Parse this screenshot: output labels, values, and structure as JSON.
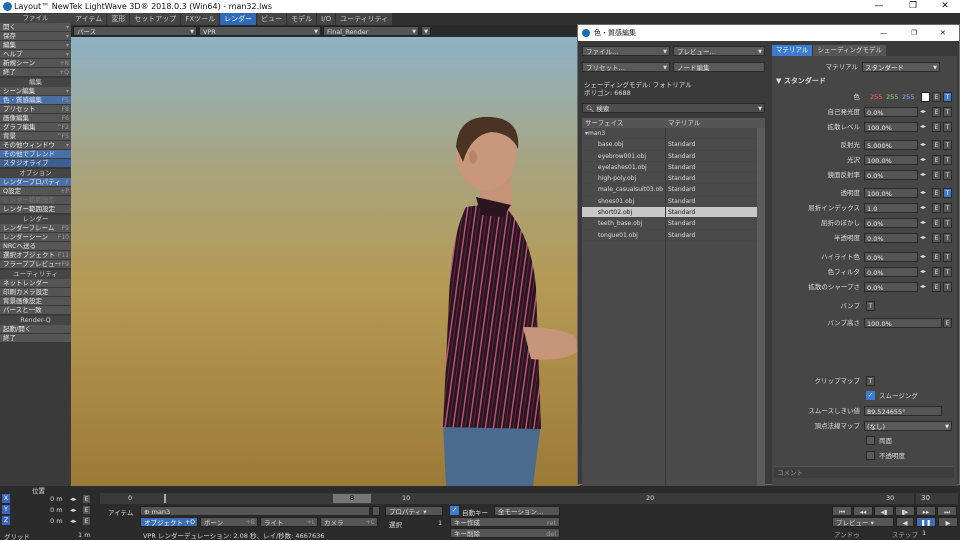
{
  "window": {
    "title": "Layout™ NewTek LightWave 3D® 2018.0.3 (Win64) - man32.lws",
    "controls": [
      "—",
      "❐",
      "✕"
    ]
  },
  "sidebar": {
    "sections": [
      {
        "title": "ファイル",
        "items": [
          {
            "label": "開く",
            "key": "▾"
          },
          {
            "label": "保存",
            "key": "▾"
          },
          {
            "label": "編集",
            "key": "▾"
          },
          {
            "label": "ヘルプ",
            "key": "▾"
          },
          {
            "label": "新規シーン",
            "key": "+N"
          },
          {
            "label": "終了",
            "key": "+Q"
          }
        ]
      },
      {
        "title": "編集",
        "items": [
          {
            "label": "シーン編集",
            "key": "▾"
          },
          {
            "label": "色・質感編集",
            "key": "F5",
            "active": true
          },
          {
            "label": "プリセット",
            "key": "F8"
          },
          {
            "label": "画像編集",
            "key": "F6"
          },
          {
            "label": "グラフ編集",
            "key": "^F2"
          },
          {
            "label": "背景",
            "key": "^F5"
          },
          {
            "label": "その他ウィンドウ",
            "key": "▾"
          },
          {
            "label": "その他でブレンド",
            "key": "",
            "active": true
          },
          {
            "label": "スタジオライブ",
            "key": "",
            "active2": true
          }
        ]
      },
      {
        "title": "オプション",
        "items": [
          {
            "label": "レンダープロパティ",
            "key": "F",
            "active": true
          },
          {
            "label": "Q設定",
            "key": "+P"
          },
          {
            "label": "レンダー範囲設定",
            "key": "",
            "disabled": true
          },
          {
            "label": "レンダー範囲設定",
            "key": ""
          }
        ]
      },
      {
        "title": "レンダー",
        "items": [
          {
            "label": "レンダーフレーム",
            "key": "F9"
          },
          {
            "label": "レンダーシーン",
            "key": "F10"
          },
          {
            "label": "NRCへ送る",
            "key": ""
          },
          {
            "label": "選択オブジェクト",
            "key": "F11"
          },
          {
            "label": "フラーブプレビュー",
            "key": "+F9"
          }
        ]
      },
      {
        "title": "ユーティリティ",
        "items": [
          {
            "label": "ネットレンダー",
            "key": ""
          },
          {
            "label": "印刷カメラ設定",
            "key": ""
          },
          {
            "label": "背景画像設定",
            "key": ""
          },
          {
            "label": "パースと一致",
            "key": ""
          }
        ]
      },
      {
        "title": "Render-Q",
        "items": [
          {
            "label": "起動/開く",
            "key": ""
          },
          {
            "label": "終了",
            "key": ""
          }
        ]
      }
    ]
  },
  "menubar": {
    "tabs": [
      "アイテム",
      "変形",
      "セットアップ",
      "FXツール",
      "レンダー",
      "ビュー",
      "モデル",
      "I/O",
      "ユーティリティ"
    ],
    "active": "レンダー"
  },
  "viewbar": {
    "view": "パース",
    "mode": "VPR",
    "render": "Final_Render"
  },
  "dialog": {
    "title": "色・質感編集",
    "file_btn": "ファイル…",
    "preview_btn": "プレビュー…",
    "preset_btn": "プリセット…",
    "node_btn": "ノード編集",
    "shading_model": "シェーディングモデル: フォトリアル",
    "polygons": "ポリゴン: 6688",
    "search": "検索",
    "col_surface": "サーフェイス",
    "col_material": "マテリアル",
    "root": "man3",
    "surfaces": [
      {
        "name": "base.obj",
        "material": "Standard"
      },
      {
        "name": "eyebrow001.obj",
        "material": "Standard"
      },
      {
        "name": "eyelashes01.obj",
        "material": "Standard"
      },
      {
        "name": "high-poly.obj",
        "material": "Standard"
      },
      {
        "name": "male_casualsuit03.ob",
        "material": "Standard"
      },
      {
        "name": "shoes01.obj",
        "material": "Standard"
      },
      {
        "name": "short02.obj",
        "material": "Standard",
        "selected": true
      },
      {
        "name": "teeth_base.obj",
        "material": "Standard"
      },
      {
        "name": "tongue01.obj",
        "material": "Standard"
      }
    ],
    "right_tabs": [
      "マテリアル",
      "シェーディングモデル"
    ],
    "material_label": "マテリアル",
    "material_value": "スタンダード",
    "group_title": "スタンダード",
    "color": {
      "label": "色",
      "r": "255",
      "g": "255",
      "b": "255",
      "r_color": "#ff6b6b",
      "g_color": "#7ee07e",
      "b_color": "#8aa8ff"
    },
    "params": [
      {
        "label": "自己発光度",
        "value": "0.0%"
      },
      {
        "label": "拡散レベル",
        "value": "100.0%"
      },
      {
        "label": "反射光",
        "value": "5.000%"
      },
      {
        "label": "光沢",
        "value": "100.0%"
      },
      {
        "label": "鏡面反射率",
        "value": "0.0%"
      },
      {
        "label": "透明度",
        "value": "100.0%"
      },
      {
        "label": "屈折インデックス",
        "value": "1.0"
      },
      {
        "label": "屈折のぼかし",
        "value": "0.0%"
      },
      {
        "label": "半透明度",
        "value": "0.0%"
      },
      {
        "label": "ハイライト色",
        "value": "0.0%"
      },
      {
        "label": "色フィルタ",
        "value": "0.0%"
      },
      {
        "label": "拡散のシャープさ",
        "value": "0.0%"
      }
    ],
    "bump_label": "バンプ",
    "bump_height_label": "バンプ高さ",
    "bump_height": "100.0%",
    "clip_label": "クリップマップ",
    "smoothing_label": "スムージング",
    "smooth_threshold_label": "スムースしきい値",
    "smooth_threshold": "89.524655°",
    "vertex_normal_label": "頂点法線マップ",
    "vertex_normal_value": "(なし)",
    "double_sided": "両面",
    "opaque": "不透明度",
    "comment": "コメント",
    "btn_e": "E",
    "btn_t": "T"
  },
  "timeline": {
    "position_label": "位置",
    "axes": [
      {
        "axis": "X",
        "value": "0 m"
      },
      {
        "axis": "Y",
        "value": "0 m"
      },
      {
        "axis": "Z",
        "value": "0 m"
      }
    ],
    "grid_label": "グリッド",
    "grid_value": "1 m",
    "ticks": [
      "0",
      "10",
      "20",
      "30"
    ],
    "current_frame": "8",
    "end_frame": "30",
    "item_label": "アイテム",
    "item_value": "man3",
    "objects_label": "オブジェクト",
    "objects_key": "+O",
    "bones_label": "ボーン",
    "bones_key": "+B",
    "lights_label": "ライト",
    "lights_key": "+L",
    "cameras_label": "カメラ",
    "cameras_key": "+C",
    "properties_label": "プロパティ",
    "select_label": "選択",
    "select_count": "1",
    "autokey_label": "自動キー",
    "automotion": "全モーション…",
    "create_key": "キー作成",
    "create_key_hint": "ret",
    "delete_key": "キー削除",
    "delete_key_hint": "del",
    "status": "VPR レンダーデュレーション: 2.08 秒、レイ/秒数: 4667636",
    "preview_btn": "プレビュー",
    "step_label": "ステップ",
    "step_value": "1",
    "anim_label": "アンドゥ"
  }
}
